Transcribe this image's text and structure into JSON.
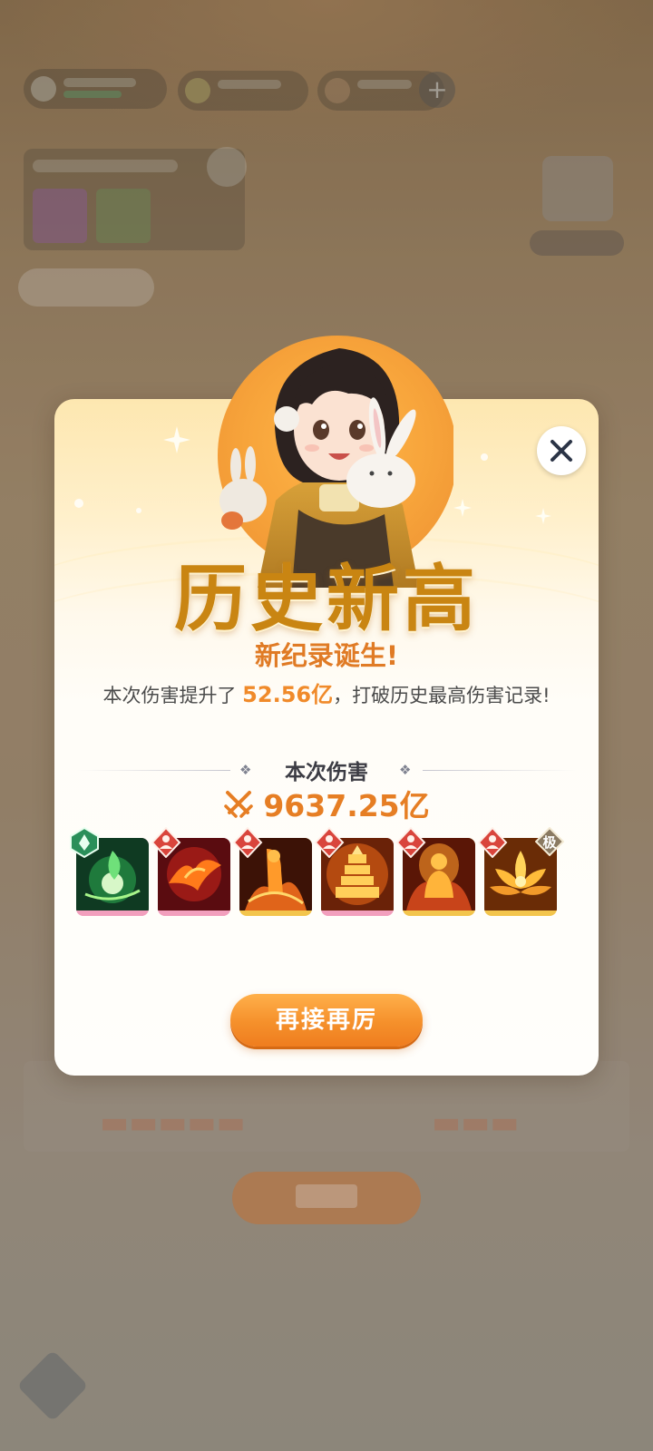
{
  "dialog": {
    "title": "历史新高",
    "subtitle": "新纪录诞生!",
    "desc_prefix": "本次伤害提升了 ",
    "desc_highlight": "52.56亿",
    "desc_suffix": "，打破历史最高伤害记录!",
    "section_label": "本次伤害",
    "damage_value": "9637.25亿",
    "primary_button": "再接再厉",
    "close_icon": "close-icon"
  },
  "skills": [
    {
      "name": "green-spirit-skill",
      "badge": "nature-badge",
      "frame": "pink"
    },
    {
      "name": "phoenix-skill",
      "badge": "monk-badge",
      "frame": "pink"
    },
    {
      "name": "flame-figure-skill",
      "badge": "monk-badge",
      "frame": "gold"
    },
    {
      "name": "golden-pagoda-skill",
      "badge": "monk-badge",
      "frame": "pink"
    },
    {
      "name": "golden-buddha-skill",
      "badge": "monk-badge",
      "frame": "gold"
    },
    {
      "name": "golden-lotus-skill",
      "badge": "monk-badge",
      "frame": "gold",
      "tier_label": "极"
    }
  ],
  "colors": {
    "title": "#c98512",
    "highlight": "#f08a2a",
    "button": "#f5902b",
    "pink_frame": "#f29fbd",
    "gold_frame": "#f3c54c"
  }
}
